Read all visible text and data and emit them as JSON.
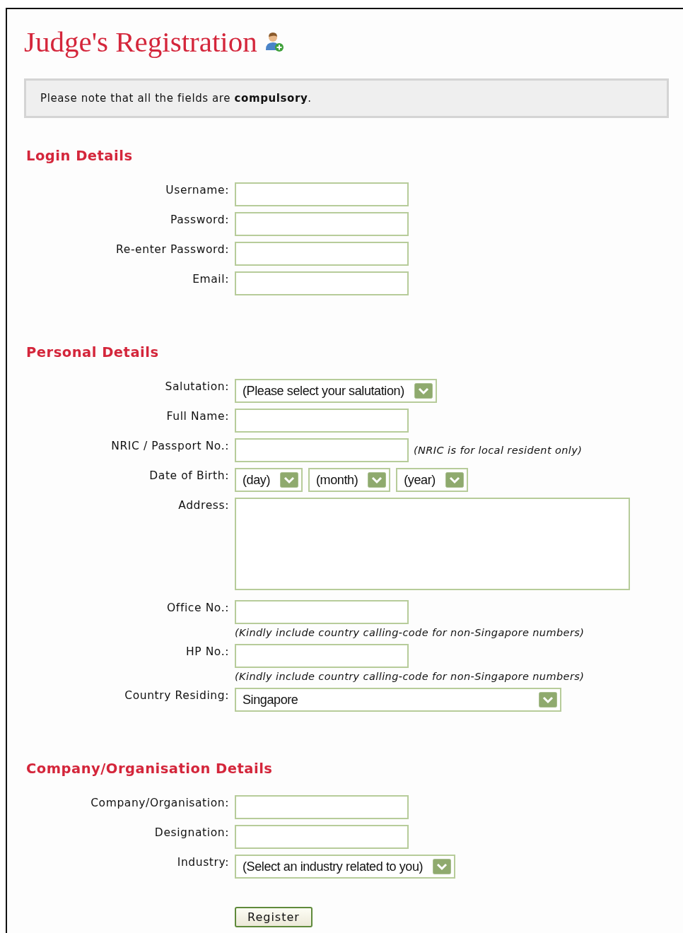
{
  "title": "Judge's Registration",
  "notice": "Please note that all the fields are **compulsory**.",
  "sections": [
    {
      "heading": "Login Details",
      "fields": [
        {
          "label": "Username:",
          "kind": "text"
        },
        {
          "label": "Password:",
          "kind": "text"
        },
        {
          "label": "Re-enter Password:",
          "kind": "text"
        },
        {
          "label": "Email:",
          "kind": "text"
        }
      ]
    },
    {
      "heading": "Personal Details",
      "fields": [
        {
          "label": "Salutation:",
          "kind": "select",
          "value": "(Please select your salutation)"
        },
        {
          "label": "Full Name:",
          "kind": "text"
        },
        {
          "label": "NRIC / Passport No.:",
          "kind": "text",
          "side_note": "(NRIC is for local resident only)"
        },
        {
          "label": "Date of Birth:",
          "kind": "date",
          "parts": [
            "(day)",
            "(month)",
            "(year)"
          ]
        },
        {
          "label": "Address:",
          "kind": "textarea"
        },
        {
          "label": "Office No.:",
          "kind": "text",
          "note_below": "(Kindly include country calling-code for non-Singapore numbers)"
        },
        {
          "label": "HP No.:",
          "kind": "text",
          "note_below": "(Kindly include country calling-code for non-Singapore numbers)"
        },
        {
          "label": "Country Residing:",
          "kind": "wide-select",
          "value": "Singapore"
        }
      ]
    },
    {
      "heading": "Company/Organisation Details",
      "fields": [
        {
          "label": "Company/Organisation:",
          "kind": "text"
        },
        {
          "label": "Designation:",
          "kind": "text"
        },
        {
          "label": "Industry:",
          "kind": "select",
          "value": "(Select an industry related to you)"
        }
      ]
    }
  ],
  "submit": "Register"
}
